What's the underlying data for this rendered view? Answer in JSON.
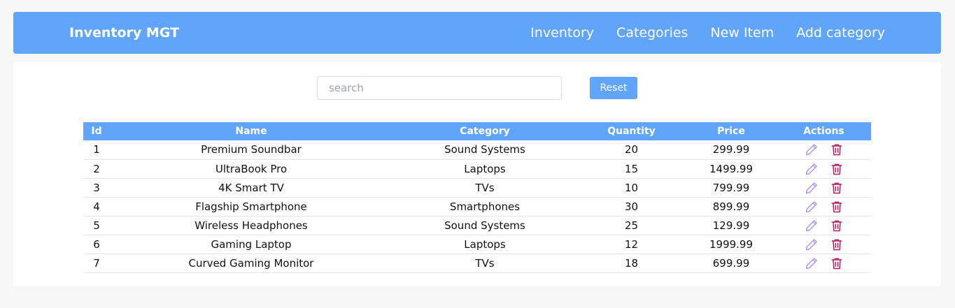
{
  "app": {
    "brand": "Inventory MGT"
  },
  "nav": {
    "links": [
      "Inventory",
      "Categories",
      "New Item",
      "Add category"
    ]
  },
  "search": {
    "placeholder": "search",
    "value": ""
  },
  "reset_label": "Reset",
  "table": {
    "headers": [
      "Id",
      "Name",
      "Category",
      "Quantity",
      "Price",
      "Actions"
    ],
    "rows": [
      {
        "id": "1",
        "name": "Premium Soundbar",
        "category": "Sound Systems",
        "quantity": "20",
        "price": "299.99"
      },
      {
        "id": "2",
        "name": "UltraBook Pro",
        "category": "Laptops",
        "quantity": "15",
        "price": "1499.99"
      },
      {
        "id": "3",
        "name": "4K Smart TV",
        "category": "TVs",
        "quantity": "10",
        "price": "799.99"
      },
      {
        "id": "4",
        "name": "Flagship Smartphone",
        "category": "Smartphones",
        "quantity": "30",
        "price": "899.99"
      },
      {
        "id": "5",
        "name": "Wireless Headphones",
        "category": "Sound Systems",
        "quantity": "25",
        "price": "129.99"
      },
      {
        "id": "6",
        "name": "Gaming Laptop",
        "category": "Laptops",
        "quantity": "12",
        "price": "1999.99"
      },
      {
        "id": "7",
        "name": "Curved Gaming Monitor",
        "category": "TVs",
        "quantity": "18",
        "price": "699.99"
      }
    ]
  },
  "icons": {
    "edit": "pencil-icon",
    "delete": "trash-icon"
  },
  "colors": {
    "accent": "#60a5fa",
    "edit": "#a78bfa",
    "delete": "#be185d",
    "background": "#f7f7f7"
  }
}
